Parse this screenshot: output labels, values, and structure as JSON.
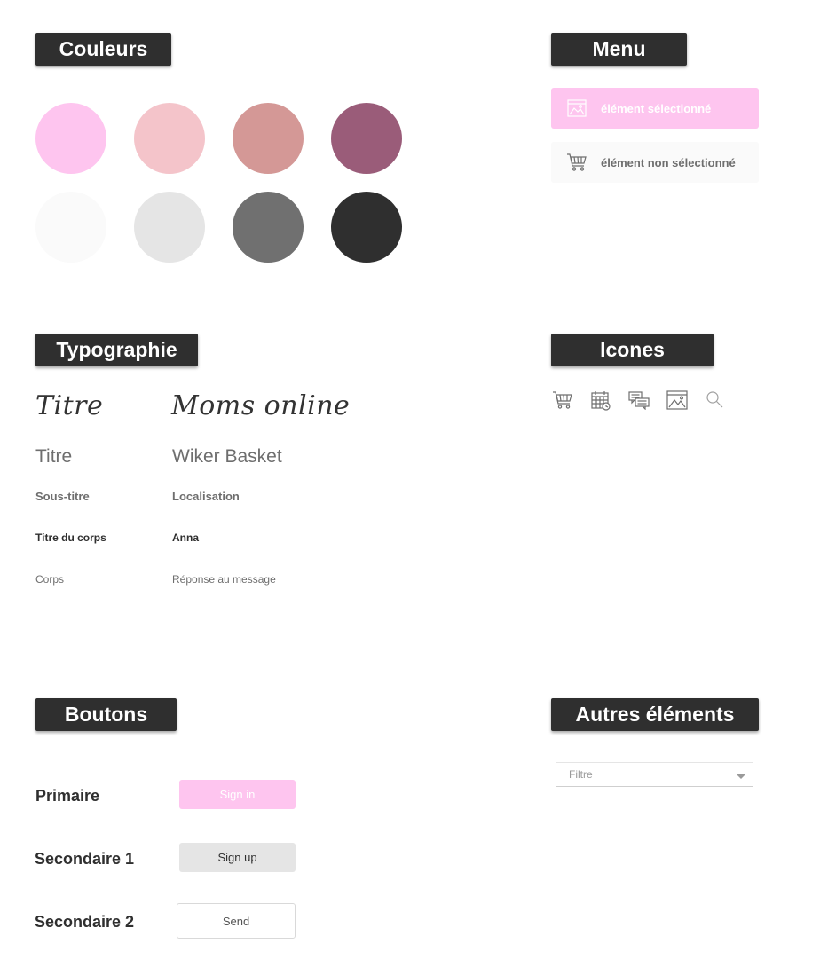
{
  "sections": {
    "couleurs": "Couleurs",
    "menu": "Menu",
    "typographie": "Typographie",
    "icones": "Icones",
    "boutons": "Boutons",
    "autres": "Autres éléments"
  },
  "colors": {
    "row1": [
      "#fec5ef",
      "#f4c4ca",
      "#d49896",
      "#9a5c79"
    ],
    "row2": [
      "#fafafa",
      "#e5e5e5",
      "#707070",
      "#2f2f2f"
    ]
  },
  "menu": {
    "selected_label": "élément sélectionné",
    "selected_icon": "image-icon",
    "unselected_label": "élément non sélectionné",
    "unselected_icon": "cart-icon",
    "accent": "#fec5ef"
  },
  "icons": [
    "cart-icon",
    "calendar-icon",
    "chat-icon",
    "image-icon",
    "search-icon"
  ],
  "typography": {
    "script_left": "Titre",
    "script_right": "Moms online",
    "title_left": "Titre",
    "title_right": "Wiker Basket",
    "subtitle_left": "Sous-titre",
    "subtitle_right": "Localisation",
    "body_title_left": "Titre du corps",
    "body_title_right": "Anna",
    "body_left": "Corps",
    "body_right": "Réponse au message"
  },
  "buttons": {
    "primary_label": "Primaire",
    "primary_text": "Sign in",
    "secondary1_label": "Secondaire 1",
    "secondary1_text": "Sign up",
    "secondary2_label": "Secondaire 2",
    "secondary2_text": "Send"
  },
  "other": {
    "filter_placeholder": "Filtre"
  }
}
